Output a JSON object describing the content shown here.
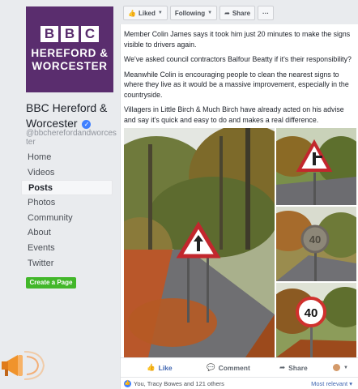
{
  "logo": {
    "blocks": [
      "B",
      "B",
      "C"
    ],
    "line1": "HEREFORD &",
    "line2": "WORCESTER"
  },
  "page": {
    "name": "BBC Hereford & Worcester",
    "handle": "@bbcherefordandworcester"
  },
  "nav": [
    "Home",
    "Videos",
    "Posts",
    "Photos",
    "Community",
    "About",
    "Events",
    "Twitter"
  ],
  "active_nav": "Posts",
  "create_page_label": "Create a Page",
  "action_bar": {
    "liked": "Liked",
    "following": "Following",
    "share": "Share",
    "more": "···"
  },
  "post": {
    "paragraphs": [
      "Member Colin James says it took him just 20 minutes to make the signs visible to drivers again.",
      "We've asked council contractors Balfour Beatty if it's their responsibility?",
      "Meanwhile Colin is encouraging people to clean the nearest signs to where they live as it would be a massive improvement, especially in the countryside.",
      "Villagers in Little Birch & Much Birch have already acted on his advise and say it's quick and easy to do and makes a real difference."
    ],
    "sign_value": "40"
  },
  "engagement": {
    "like": "Like",
    "comment": "Comment",
    "share": "Share"
  },
  "reactions": {
    "text": "You, Tracy Bowes and 121 others",
    "sort": "Most relevant ▾"
  },
  "colors": {
    "brand_purple": "#5a2d6e",
    "facebook_blue": "#4267b2",
    "create_green": "#42b72a",
    "sign_red": "#d0312d"
  }
}
